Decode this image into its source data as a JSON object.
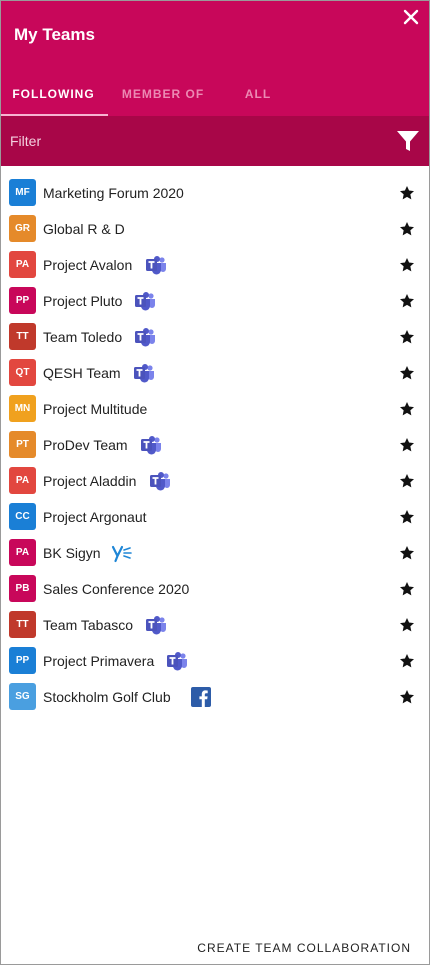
{
  "header": {
    "title": "My Teams",
    "close_icon": "close-icon"
  },
  "tabs": [
    {
      "label": "FOLLOWING",
      "active": true
    },
    {
      "label": "MEMBER OF",
      "active": false
    },
    {
      "label": "ALL",
      "active": false
    }
  ],
  "filter": {
    "placeholder": "Filter",
    "value": "",
    "icon": "filter-icon"
  },
  "teams": [
    {
      "initials": "MF",
      "name": "Marketing Forum 2020",
      "color": "#1a7fd6",
      "app": null
    },
    {
      "initials": "GR",
      "name": "Global R & D",
      "color": "#e58a2a",
      "app": null
    },
    {
      "initials": "PA",
      "name": "Project Avalon",
      "color": "#e2473f",
      "app": "teams"
    },
    {
      "initials": "PP",
      "name": "Project Pluto",
      "color": "#c8075a",
      "app": "teams"
    },
    {
      "initials": "TT",
      "name": "Team Toledo",
      "color": "#c0392b",
      "app": "teams"
    },
    {
      "initials": "QT",
      "name": "QESH Team",
      "color": "#e2473f",
      "app": "teams"
    },
    {
      "initials": "MN",
      "name": "Project Multitude",
      "color": "#f0a11e",
      "app": null
    },
    {
      "initials": "PT",
      "name": "ProDev Team",
      "color": "#e58a2a",
      "app": "teams"
    },
    {
      "initials": "PA",
      "name": "Project Aladdin",
      "color": "#e2473f",
      "app": "teams"
    },
    {
      "initials": "CC",
      "name": "Project Argonaut",
      "color": "#1a7fd6",
      "app": null
    },
    {
      "initials": "PA",
      "name": "BK Sigyn",
      "color": "#c8075a",
      "app": "yammer"
    },
    {
      "initials": "PB",
      "name": "Sales Conference 2020",
      "color": "#c8075a",
      "app": null
    },
    {
      "initials": "TT",
      "name": "Team Tabasco",
      "color": "#c0392b",
      "app": "teams"
    },
    {
      "initials": "PP",
      "name": "Project Primavera",
      "color": "#1a7fd6",
      "app": "teams"
    },
    {
      "initials": "SG",
      "name": "Stockholm Golf Club",
      "color": "#4a9fe0",
      "app": "facebook"
    }
  ],
  "footer": {
    "create_label": "CREATE TEAM COLLABORATION"
  },
  "colors": {
    "header": "#c8075a",
    "filter_bar": "#a80648"
  }
}
